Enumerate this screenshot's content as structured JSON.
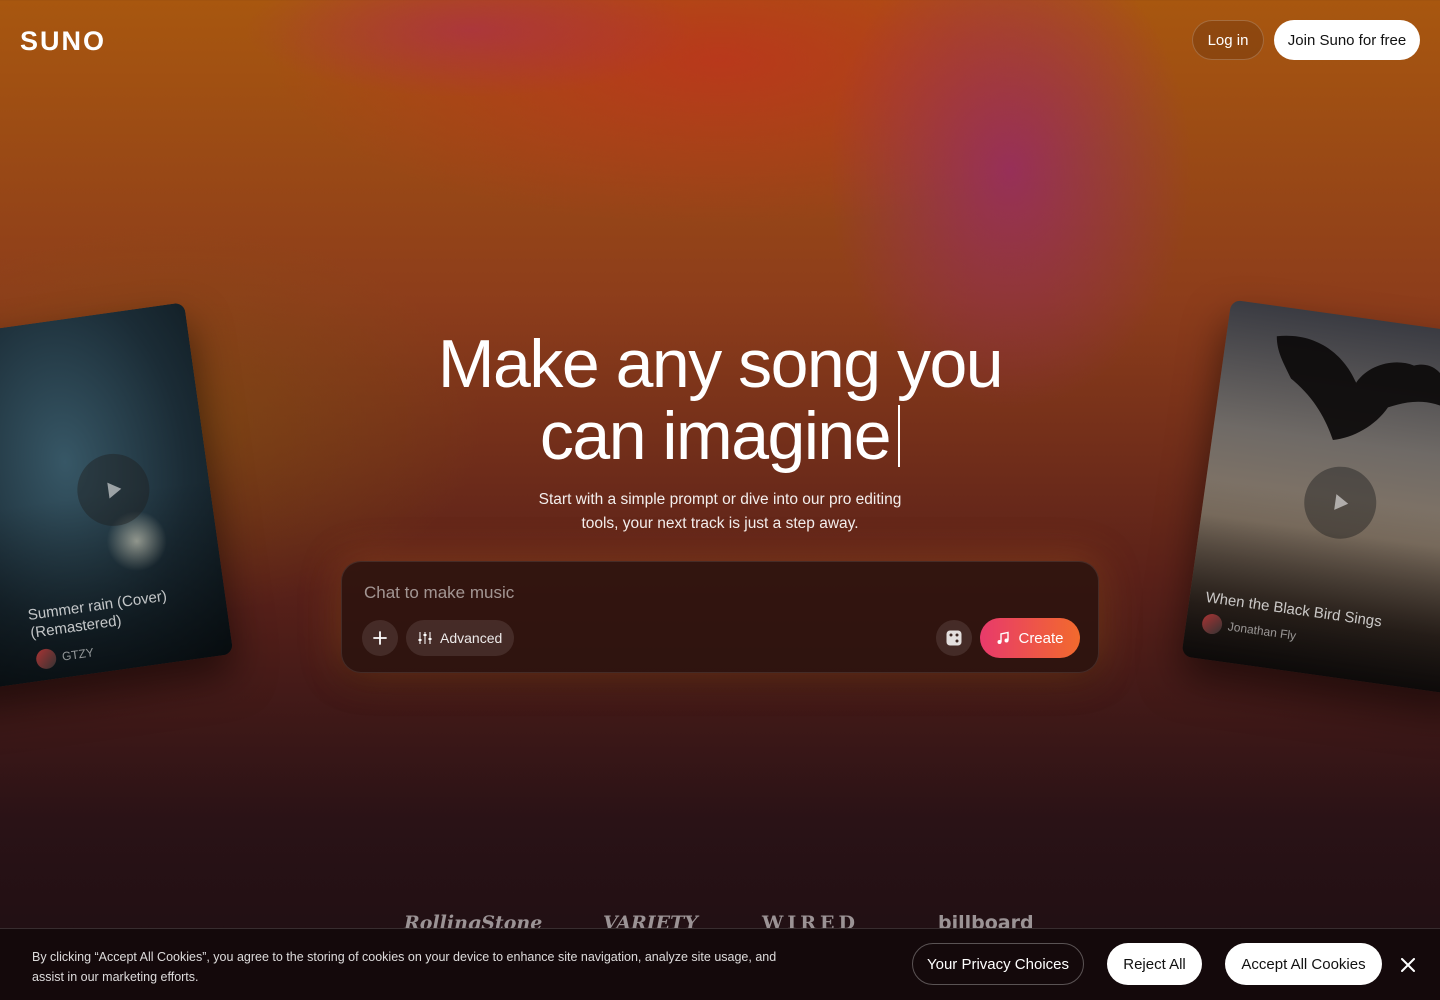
{
  "header": {
    "logo": "SUNO",
    "login_label": "Log in",
    "join_label": "Join Suno for free"
  },
  "hero": {
    "headline_line1": "Make any song you",
    "headline_line2": "can imagine",
    "subtitle_line1": "Start with a simple prompt or dive into our pro editing",
    "subtitle_line2": "tools, your next track is just a step away."
  },
  "prompt": {
    "placeholder": "Chat to make music",
    "advanced_label": "Advanced",
    "create_label": "Create",
    "icons": {
      "add": "plus-icon",
      "advanced": "sliders-icon",
      "random": "dice-icon",
      "create": "music-note-icon"
    }
  },
  "cards": [
    {
      "title": "Summer rain (Cover) (Remastered)",
      "artist": "GTZY"
    },
    {
      "title": "When the Black Bird Sings",
      "artist": "Jonathan Fly"
    }
  ],
  "press_logos": [
    "RollingStone",
    "VARIETY",
    "WIRED",
    "billboard"
  ],
  "cookie_banner": {
    "text": "By clicking “Accept All Cookies”, you agree to the storing of cookies on your device to enhance site navigation, analyze site usage, and assist in our marketing efforts.",
    "privacy_label": "Your Privacy Choices",
    "reject_label": "Reject All",
    "accept_label": "Accept All Cookies"
  },
  "colors": {
    "create_gradient_start": "#e83a6b",
    "create_gradient_end": "#f26a2d",
    "cookie_bg": "#14090b"
  }
}
